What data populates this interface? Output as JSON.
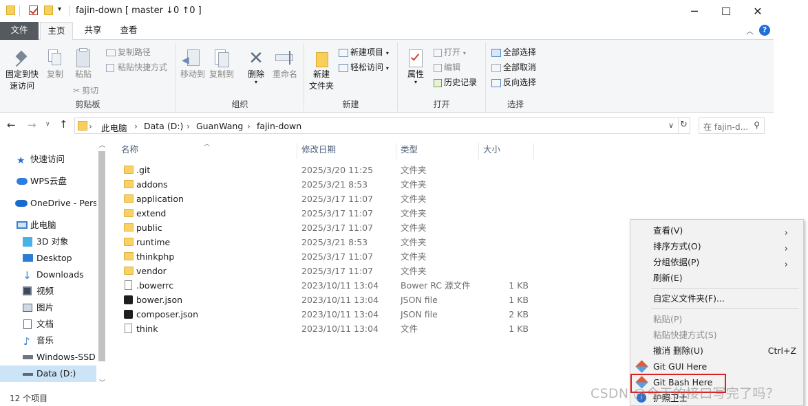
{
  "window": {
    "title": "fajin-down [ master ↓0 ↑0 ]",
    "minimize": "─",
    "maximize": "☐",
    "close": "✕"
  },
  "tabs": [
    "文件",
    "主页",
    "共享",
    "查看"
  ],
  "ribbon": {
    "clipboard": {
      "label": "剪贴板",
      "pin": "固定到快\n速访问",
      "copy": "复制",
      "paste": "粘贴",
      "copy_path": "复制路径",
      "paste_shortcut": "粘贴快捷方式",
      "cut": "剪切"
    },
    "organize": {
      "label": "组织",
      "move_to": "移动到",
      "copy_to": "复制到",
      "delete": "删除",
      "rename": "重命名"
    },
    "new": {
      "label": "新建",
      "new_folder": "新建\n文件夹",
      "new_item": "新建项目",
      "easy_access": "轻松访问"
    },
    "open": {
      "label": "打开",
      "properties": "属性",
      "open": "打开",
      "edit": "编辑",
      "history": "历史记录"
    },
    "select": {
      "label": "选择",
      "select_all": "全部选择",
      "select_none": "全部取消",
      "invert": "反向选择"
    }
  },
  "address": {
    "crumbs": [
      "此电脑",
      "Data (D:)",
      "GuanWang",
      "fajin-down"
    ],
    "search_placeholder": "在 fajin-d..."
  },
  "sidebar": {
    "items": [
      {
        "label": "快速访问",
        "icon": "star-icon"
      },
      {
        "label": "WPS云盘",
        "icon": "cloud-icon"
      },
      {
        "label": "OneDrive - Perso",
        "icon": "onedrive-icon"
      },
      {
        "label": "此电脑",
        "icon": "computer-icon"
      },
      {
        "label": "3D 对象",
        "icon": "cube-icon"
      },
      {
        "label": "Desktop",
        "icon": "desktop-icon"
      },
      {
        "label": "Downloads",
        "icon": "download-icon"
      },
      {
        "label": "视频",
        "icon": "video-icon"
      },
      {
        "label": "图片",
        "icon": "picture-icon"
      },
      {
        "label": "文档",
        "icon": "document-icon"
      },
      {
        "label": "音乐",
        "icon": "music-icon"
      },
      {
        "label": "Windows-SSD",
        "icon": "drive-icon"
      },
      {
        "label": "Data (D:)",
        "icon": "drive-icon"
      }
    ]
  },
  "columns": [
    "名称",
    "修改日期",
    "类型",
    "大小"
  ],
  "files": [
    {
      "name": ".git",
      "date": "2025/3/20 11:25",
      "type": "文件夹",
      "size": "",
      "kind": "folder"
    },
    {
      "name": "addons",
      "date": "2025/3/21 8:53",
      "type": "文件夹",
      "size": "",
      "kind": "folder"
    },
    {
      "name": "application",
      "date": "2025/3/17 11:07",
      "type": "文件夹",
      "size": "",
      "kind": "folder"
    },
    {
      "name": "extend",
      "date": "2025/3/17 11:07",
      "type": "文件夹",
      "size": "",
      "kind": "folder"
    },
    {
      "name": "public",
      "date": "2025/3/17 11:07",
      "type": "文件夹",
      "size": "",
      "kind": "folder"
    },
    {
      "name": "runtime",
      "date": "2025/3/21 8:53",
      "type": "文件夹",
      "size": "",
      "kind": "folder"
    },
    {
      "name": "thinkphp",
      "date": "2025/3/17 11:07",
      "type": "文件夹",
      "size": "",
      "kind": "folder"
    },
    {
      "name": "vendor",
      "date": "2025/3/17 11:07",
      "type": "文件夹",
      "size": "",
      "kind": "folder"
    },
    {
      "name": ".bowerrc",
      "date": "2023/10/11 13:04",
      "type": "Bower RC 源文件",
      "size": "1 KB",
      "kind": "doc"
    },
    {
      "name": "bower.json",
      "date": "2023/10/11 13:04",
      "type": "JSON file",
      "size": "1 KB",
      "kind": "json"
    },
    {
      "name": "composer.json",
      "date": "2023/10/11 13:04",
      "type": "JSON file",
      "size": "2 KB",
      "kind": "json"
    },
    {
      "name": "think",
      "date": "2023/10/11 13:04",
      "type": "文件",
      "size": "1 KB",
      "kind": "doc"
    }
  ],
  "status": "12 个项目",
  "context_menu": {
    "items": [
      {
        "label": "查看(V)",
        "submenu": true,
        "disabled": false
      },
      {
        "label": "排序方式(O)",
        "submenu": true,
        "disabled": false
      },
      {
        "label": "分组依据(P)",
        "submenu": true,
        "disabled": false
      },
      {
        "label": "刷新(E)",
        "submenu": false,
        "disabled": false
      },
      {
        "label": "自定义文件夹(F)...",
        "submenu": false,
        "disabled": false
      },
      {
        "label": "粘贴(P)",
        "submenu": false,
        "disabled": true
      },
      {
        "label": "粘贴快捷方式(S)",
        "submenu": false,
        "disabled": true
      },
      {
        "label": "撤消 删除(U)",
        "shortcut": "Ctrl+Z",
        "submenu": false,
        "disabled": false
      },
      {
        "label": "Git GUI Here",
        "submenu": false,
        "disabled": false
      },
      {
        "label": "Git Bash Here",
        "submenu": false,
        "disabled": false,
        "highlighted": true
      },
      {
        "label": "护照卫士",
        "submenu": false,
        "disabled": false
      }
    ],
    "highlight_color": "#e02020"
  },
  "watermark": "CSDN @今天的接口写完了吗？"
}
